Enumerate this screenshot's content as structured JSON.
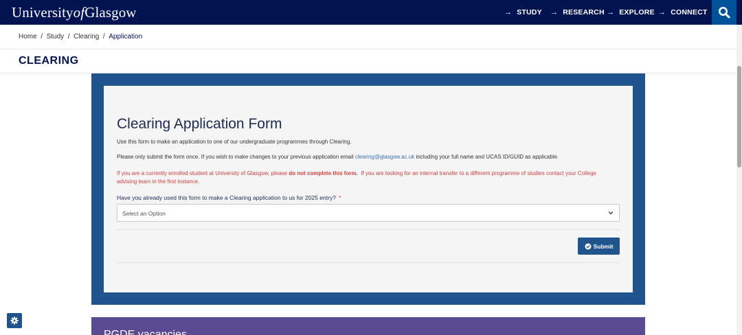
{
  "header": {
    "logo_left": "University",
    "logo_of": "of",
    "logo_right": "Glasgow",
    "nav": [
      {
        "label": "STUDY"
      },
      {
        "label": "RESEARCH"
      },
      {
        "label": "EXPLORE"
      },
      {
        "label": "CONNECT"
      }
    ],
    "search_icon": "search-icon"
  },
  "breadcrumb": {
    "items": [
      "Home",
      "Study",
      "Clearing"
    ],
    "current": "Application",
    "separator": "/"
  },
  "section_title": "CLEARING",
  "form": {
    "title": "Clearing Application Form",
    "intro": "Use this form to make an application to one of our undergraduate programmes through Clearing.",
    "once_pre": "Please only submit the form once. If you wish to make changes to your previous application email ",
    "email": "clearing@glasgow.ac.uk",
    "once_post": " including your full name and UCAS ID/GUID as applicable.",
    "warn_pre": "If you are a currently enrolled student at University of Glasgow, please ",
    "warn_bold": "do not complete this form.",
    "warn_post": "  If you are looking for an internal transfer to a different programme of studies contact your College advising team in the first instance.",
    "question": "Have you already used this form to make a Clearing application to us for 2025 entry?",
    "required_mark": "*",
    "select_value": "Select an Option",
    "submit_label": "Submit"
  },
  "next_section": {
    "title": "PGDE vacancies"
  },
  "colors": {
    "navy": "#011451",
    "panel_blue": "#21538f",
    "purple": "#5a4a91",
    "warning_red": "#d23e3e"
  }
}
